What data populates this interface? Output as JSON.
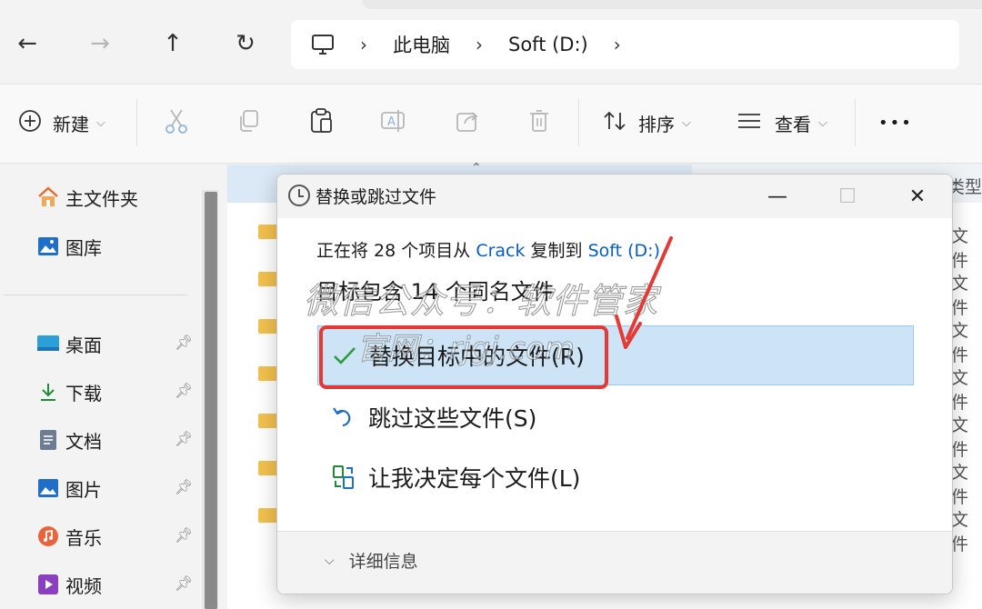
{
  "address_bar": {
    "back_icon": "←",
    "forward_icon": "→",
    "up_icon": "↑",
    "refresh_icon": "↻",
    "breadcrumb": [
      "此电脑",
      "Soft (D:)"
    ]
  },
  "toolbar": {
    "new_label": "新建",
    "sort_label": "排序",
    "view_label": "查看",
    "more_label": "•••"
  },
  "sidebar": {
    "items": [
      {
        "label": "主文件夹"
      },
      {
        "label": "图库"
      },
      {
        "label": "桌面"
      },
      {
        "label": "下载"
      },
      {
        "label": "文档"
      },
      {
        "label": "图片"
      },
      {
        "label": "音乐"
      },
      {
        "label": "视频"
      }
    ]
  },
  "file_list": {
    "type_header": "类型",
    "row_type": "文件"
  },
  "dialog": {
    "title": "替换或跳过文件",
    "message_prefix": "正在将 28 个项目从",
    "source": "Crack",
    "message_mid": "复制到",
    "destination": "Soft (D:)",
    "heading": "目标包含 14 个同名文件",
    "options": [
      {
        "label": "替换目标中的文件(R)"
      },
      {
        "label": "跳过这些文件(S)"
      },
      {
        "label": "让我决定每个文件(L)"
      }
    ],
    "details_label": "详细信息",
    "minimize_icon": "—",
    "maximize_icon": "☐",
    "close_icon": "✕"
  },
  "annotation": {
    "watermark_line1": "微信公众号：软件管家",
    "watermark_line2": "官网：rjgj.com",
    "highlight_color": "#e53935"
  }
}
